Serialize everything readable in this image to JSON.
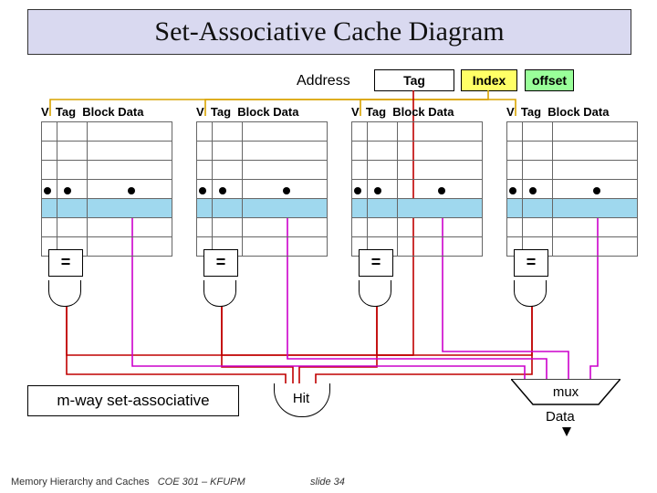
{
  "title": "Set-Associative Cache Diagram",
  "address": {
    "label": "Address",
    "tag": "Tag",
    "index": "Index",
    "offset": "offset"
  },
  "way_header": "V  Tag  Block Data",
  "comparator": "=",
  "mux_label": "mux",
  "hit_label": "Hit",
  "data_label": "Data",
  "mway_label": "m-way set-associative",
  "footer": {
    "topic": "Memory Hierarchy and Caches",
    "course": "COE 301 – KFUPM",
    "slide": "slide 34"
  },
  "diagram": {
    "ways": 4,
    "rows_per_way": 7,
    "highlighted_row_index": 4,
    "columns": [
      "V",
      "Tag",
      "Block Data"
    ],
    "address_fields": [
      "Tag",
      "Index",
      "offset"
    ],
    "comparator_op": "equals",
    "hit_logic": "OR of all way comparator outputs",
    "data_select": "mux over Block Data of all ways, select = one-hot hit signals",
    "colors": {
      "title_bg": "#d9d9f0",
      "index_bg": "#ffff66",
      "offset_bg": "#99ff99",
      "selected_row": "#9fd8ee",
      "tag_wire": "#c00000",
      "data_wire": "#cc00cc",
      "index_wire": "#d9a300"
    }
  }
}
